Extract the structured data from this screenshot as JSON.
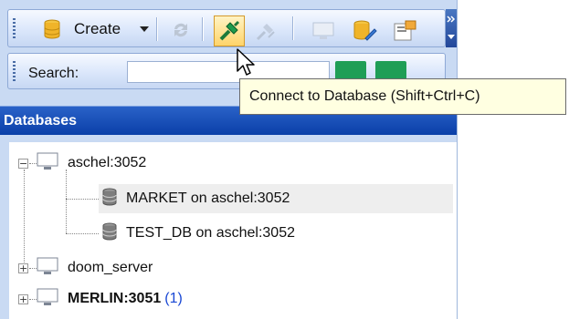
{
  "toolbar": {
    "create_label": "Create",
    "icons": [
      "database-icon",
      "refresh-icon",
      "connect-database-icon",
      "disconnect-database-icon",
      "server-icon",
      "database-edit-icon",
      "properties-icon"
    ]
  },
  "search": {
    "label": "Search:",
    "value": "",
    "placeholder": ""
  },
  "tooltip": {
    "text": "Connect to Database (Shift+Ctrl+C)"
  },
  "panel": {
    "title": "Databases"
  },
  "tree": {
    "servers": [
      {
        "label": "aschel:3052",
        "expanded": true,
        "bold": false,
        "databases": [
          {
            "label": "MARKET on aschel:3052",
            "selected": true
          },
          {
            "label": "TEST_DB on aschel:3052",
            "selected": false
          }
        ]
      },
      {
        "label": "doom_server",
        "expanded": false,
        "bold": false
      },
      {
        "label": "MERLIN:3051",
        "expanded": false,
        "bold": true,
        "count": "(1)"
      }
    ]
  },
  "colors": {
    "header": "#0a3fa8",
    "tooltip_bg": "#ffffe1",
    "count": "#1a48d4",
    "highlight": "#ffd46a"
  }
}
